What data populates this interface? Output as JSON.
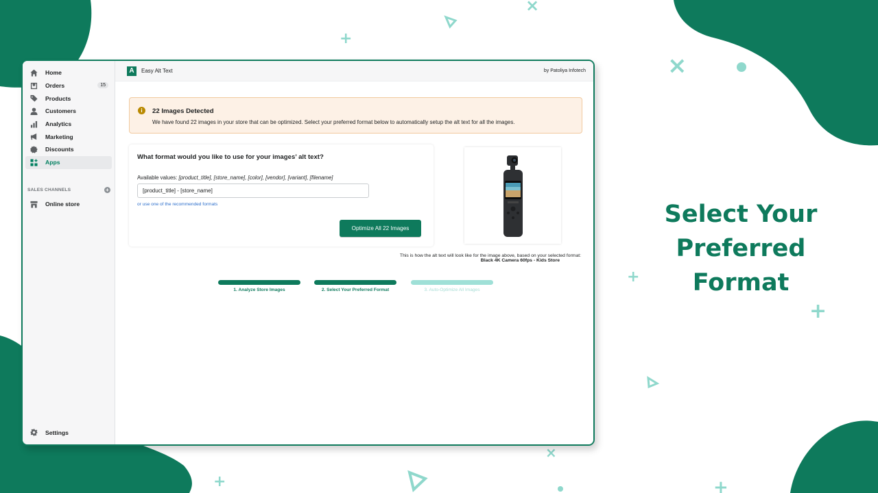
{
  "headline": {
    "line1": "Select Your Preferred",
    "line2": "Format"
  },
  "sidebar": {
    "items": [
      {
        "label": "Home",
        "icon": "home-icon"
      },
      {
        "label": "Orders",
        "icon": "orders-icon",
        "badge": "15"
      },
      {
        "label": "Products",
        "icon": "tag-icon"
      },
      {
        "label": "Customers",
        "icon": "person-icon"
      },
      {
        "label": "Analytics",
        "icon": "bar-chart-icon"
      },
      {
        "label": "Marketing",
        "icon": "megaphone-icon"
      },
      {
        "label": "Discounts",
        "icon": "discount-icon"
      },
      {
        "label": "Apps",
        "icon": "apps-icon",
        "active": true
      }
    ],
    "channels_header": "SALES CHANNELS",
    "online_store": "Online store",
    "settings": "Settings"
  },
  "topbar": {
    "app_title": "Easy Alt Text",
    "byline": "by Patoliya Infotech"
  },
  "banner": {
    "title": "22 Images Detected",
    "text": "We have found 22 images in your store that can be optimized. Select your preferred format below to automatically setup the alt text for all the images."
  },
  "format_card": {
    "question": "What format would you like to use for your images’ alt text?",
    "available_label": "Available values: ",
    "available_values": "[product_title], [store_name], [color], [vendor], [variant], [filename]",
    "input_value": "[product_title] - [store_name]",
    "recommended_link": "or use one of the recommended formats",
    "button": "Optimize All 22 Images"
  },
  "preview": {
    "caption": "This is how the alt text will look like for the image above, based on your selected format:",
    "alt_text": "Black 4K Camera 60fps - Kids Store"
  },
  "steps": [
    {
      "label": "1. Analyze Store Images",
      "done": true
    },
    {
      "label": "2. Select Your Preferred Format",
      "done": true
    },
    {
      "label": "3. Auto-Optimize All Images",
      "done": false
    }
  ],
  "colors": {
    "brand": "#0e7a5c",
    "pending": "#9fe0d7",
    "banner_bg": "#fdf1e6",
    "link": "#2c6ecb"
  }
}
